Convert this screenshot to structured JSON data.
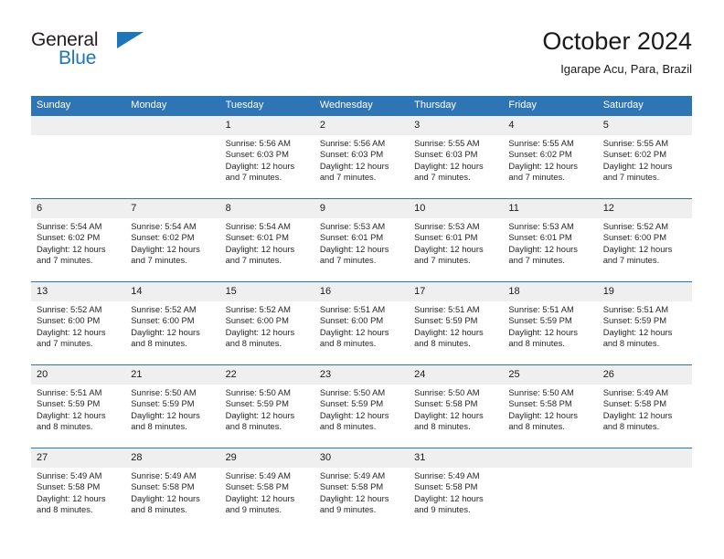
{
  "logo": {
    "word_top": "General",
    "word_bottom": "Blue",
    "triangle_icon": "triangle-icon",
    "color_dark": "#231f20",
    "color_blue": "#1d76bb"
  },
  "header": {
    "title": "October 2024",
    "subtitle": "Igarape Acu, Para, Brazil"
  },
  "theme": {
    "header_blue": "#2e75b6",
    "daynum_band": "#efefef",
    "text": "#262626"
  },
  "weekdays": [
    "Sunday",
    "Monday",
    "Tuesday",
    "Wednesday",
    "Thursday",
    "Friday",
    "Saturday"
  ],
  "labels": {
    "sunrise_prefix": "Sunrise:",
    "sunset_prefix": "Sunset:",
    "daylight_prefix": "Daylight:"
  },
  "weeks": [
    [
      {
        "day": "",
        "sunrise": "",
        "sunset": "",
        "daylight_line1": "",
        "daylight_line2": ""
      },
      {
        "day": "",
        "sunrise": "",
        "sunset": "",
        "daylight_line1": "",
        "daylight_line2": ""
      },
      {
        "day": "1",
        "sunrise": "Sunrise: 5:56 AM",
        "sunset": "Sunset: 6:03 PM",
        "daylight_line1": "Daylight: 12 hours",
        "daylight_line2": "and 7 minutes."
      },
      {
        "day": "2",
        "sunrise": "Sunrise: 5:56 AM",
        "sunset": "Sunset: 6:03 PM",
        "daylight_line1": "Daylight: 12 hours",
        "daylight_line2": "and 7 minutes."
      },
      {
        "day": "3",
        "sunrise": "Sunrise: 5:55 AM",
        "sunset": "Sunset: 6:03 PM",
        "daylight_line1": "Daylight: 12 hours",
        "daylight_line2": "and 7 minutes."
      },
      {
        "day": "4",
        "sunrise": "Sunrise: 5:55 AM",
        "sunset": "Sunset: 6:02 PM",
        "daylight_line1": "Daylight: 12 hours",
        "daylight_line2": "and 7 minutes."
      },
      {
        "day": "5",
        "sunrise": "Sunrise: 5:55 AM",
        "sunset": "Sunset: 6:02 PM",
        "daylight_line1": "Daylight: 12 hours",
        "daylight_line2": "and 7 minutes."
      }
    ],
    [
      {
        "day": "6",
        "sunrise": "Sunrise: 5:54 AM",
        "sunset": "Sunset: 6:02 PM",
        "daylight_line1": "Daylight: 12 hours",
        "daylight_line2": "and 7 minutes."
      },
      {
        "day": "7",
        "sunrise": "Sunrise: 5:54 AM",
        "sunset": "Sunset: 6:02 PM",
        "daylight_line1": "Daylight: 12 hours",
        "daylight_line2": "and 7 minutes."
      },
      {
        "day": "8",
        "sunrise": "Sunrise: 5:54 AM",
        "sunset": "Sunset: 6:01 PM",
        "daylight_line1": "Daylight: 12 hours",
        "daylight_line2": "and 7 minutes."
      },
      {
        "day": "9",
        "sunrise": "Sunrise: 5:53 AM",
        "sunset": "Sunset: 6:01 PM",
        "daylight_line1": "Daylight: 12 hours",
        "daylight_line2": "and 7 minutes."
      },
      {
        "day": "10",
        "sunrise": "Sunrise: 5:53 AM",
        "sunset": "Sunset: 6:01 PM",
        "daylight_line1": "Daylight: 12 hours",
        "daylight_line2": "and 7 minutes."
      },
      {
        "day": "11",
        "sunrise": "Sunrise: 5:53 AM",
        "sunset": "Sunset: 6:01 PM",
        "daylight_line1": "Daylight: 12 hours",
        "daylight_line2": "and 7 minutes."
      },
      {
        "day": "12",
        "sunrise": "Sunrise: 5:52 AM",
        "sunset": "Sunset: 6:00 PM",
        "daylight_line1": "Daylight: 12 hours",
        "daylight_line2": "and 7 minutes."
      }
    ],
    [
      {
        "day": "13",
        "sunrise": "Sunrise: 5:52 AM",
        "sunset": "Sunset: 6:00 PM",
        "daylight_line1": "Daylight: 12 hours",
        "daylight_line2": "and 7 minutes."
      },
      {
        "day": "14",
        "sunrise": "Sunrise: 5:52 AM",
        "sunset": "Sunset: 6:00 PM",
        "daylight_line1": "Daylight: 12 hours",
        "daylight_line2": "and 8 minutes."
      },
      {
        "day": "15",
        "sunrise": "Sunrise: 5:52 AM",
        "sunset": "Sunset: 6:00 PM",
        "daylight_line1": "Daylight: 12 hours",
        "daylight_line2": "and 8 minutes."
      },
      {
        "day": "16",
        "sunrise": "Sunrise: 5:51 AM",
        "sunset": "Sunset: 6:00 PM",
        "daylight_line1": "Daylight: 12 hours",
        "daylight_line2": "and 8 minutes."
      },
      {
        "day": "17",
        "sunrise": "Sunrise: 5:51 AM",
        "sunset": "Sunset: 5:59 PM",
        "daylight_line1": "Daylight: 12 hours",
        "daylight_line2": "and 8 minutes."
      },
      {
        "day": "18",
        "sunrise": "Sunrise: 5:51 AM",
        "sunset": "Sunset: 5:59 PM",
        "daylight_line1": "Daylight: 12 hours",
        "daylight_line2": "and 8 minutes."
      },
      {
        "day": "19",
        "sunrise": "Sunrise: 5:51 AM",
        "sunset": "Sunset: 5:59 PM",
        "daylight_line1": "Daylight: 12 hours",
        "daylight_line2": "and 8 minutes."
      }
    ],
    [
      {
        "day": "20",
        "sunrise": "Sunrise: 5:51 AM",
        "sunset": "Sunset: 5:59 PM",
        "daylight_line1": "Daylight: 12 hours",
        "daylight_line2": "and 8 minutes."
      },
      {
        "day": "21",
        "sunrise": "Sunrise: 5:50 AM",
        "sunset": "Sunset: 5:59 PM",
        "daylight_line1": "Daylight: 12 hours",
        "daylight_line2": "and 8 minutes."
      },
      {
        "day": "22",
        "sunrise": "Sunrise: 5:50 AM",
        "sunset": "Sunset: 5:59 PM",
        "daylight_line1": "Daylight: 12 hours",
        "daylight_line2": "and 8 minutes."
      },
      {
        "day": "23",
        "sunrise": "Sunrise: 5:50 AM",
        "sunset": "Sunset: 5:59 PM",
        "daylight_line1": "Daylight: 12 hours",
        "daylight_line2": "and 8 minutes."
      },
      {
        "day": "24",
        "sunrise": "Sunrise: 5:50 AM",
        "sunset": "Sunset: 5:58 PM",
        "daylight_line1": "Daylight: 12 hours",
        "daylight_line2": "and 8 minutes."
      },
      {
        "day": "25",
        "sunrise": "Sunrise: 5:50 AM",
        "sunset": "Sunset: 5:58 PM",
        "daylight_line1": "Daylight: 12 hours",
        "daylight_line2": "and 8 minutes."
      },
      {
        "day": "26",
        "sunrise": "Sunrise: 5:49 AM",
        "sunset": "Sunset: 5:58 PM",
        "daylight_line1": "Daylight: 12 hours",
        "daylight_line2": "and 8 minutes."
      }
    ],
    [
      {
        "day": "27",
        "sunrise": "Sunrise: 5:49 AM",
        "sunset": "Sunset: 5:58 PM",
        "daylight_line1": "Daylight: 12 hours",
        "daylight_line2": "and 8 minutes."
      },
      {
        "day": "28",
        "sunrise": "Sunrise: 5:49 AM",
        "sunset": "Sunset: 5:58 PM",
        "daylight_line1": "Daylight: 12 hours",
        "daylight_line2": "and 8 minutes."
      },
      {
        "day": "29",
        "sunrise": "Sunrise: 5:49 AM",
        "sunset": "Sunset: 5:58 PM",
        "daylight_line1": "Daylight: 12 hours",
        "daylight_line2": "and 9 minutes."
      },
      {
        "day": "30",
        "sunrise": "Sunrise: 5:49 AM",
        "sunset": "Sunset: 5:58 PM",
        "daylight_line1": "Daylight: 12 hours",
        "daylight_line2": "and 9 minutes."
      },
      {
        "day": "31",
        "sunrise": "Sunrise: 5:49 AM",
        "sunset": "Sunset: 5:58 PM",
        "daylight_line1": "Daylight: 12 hours",
        "daylight_line2": "and 9 minutes."
      },
      {
        "day": "",
        "sunrise": "",
        "sunset": "",
        "daylight_line1": "",
        "daylight_line2": ""
      },
      {
        "day": "",
        "sunrise": "",
        "sunset": "",
        "daylight_line1": "",
        "daylight_line2": ""
      }
    ]
  ]
}
